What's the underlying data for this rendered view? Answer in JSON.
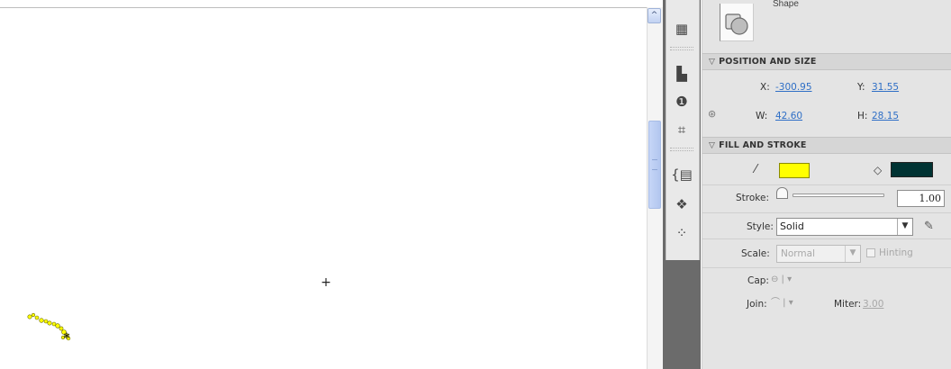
{
  "stage": {
    "crosshair_glyph": "+",
    "scatter_color": "#ffff00"
  },
  "scrollbar": {
    "up_arrow_glyph": "^"
  },
  "icon_strip": {
    "icons": [
      {
        "name": "grid-swatches-icon",
        "glyph": "▦"
      },
      {
        "name": "align-icon",
        "glyph": "▙"
      },
      {
        "name": "info-icon",
        "glyph": "❶"
      },
      {
        "name": "transform-icon",
        "glyph": "⌗"
      },
      {
        "name": "code-snippets-icon",
        "glyph": "{▤"
      },
      {
        "name": "components-icon",
        "glyph": "❖"
      },
      {
        "name": "motion-presets-icon",
        "glyph": "⁘"
      }
    ]
  },
  "properties": {
    "shape_label": "Shape",
    "position_size": {
      "header": "POSITION AND SIZE",
      "x_label": "X:",
      "x_value": "-300.95",
      "y_label": "Y:",
      "y_value": "31.55",
      "w_label": "W:",
      "w_value": "42.60",
      "h_label": "H:",
      "h_value": "28.15",
      "lock_icon": "link-icon"
    },
    "fill_stroke": {
      "header": "FILL AND STROKE",
      "stroke_color": "#ffff00",
      "fill_color": "#003333",
      "stroke_label": "Stroke:",
      "stroke_value": "1.00",
      "style_label": "Style:",
      "style_value": "Solid",
      "scale_label": "Scale:",
      "scale_value": "Normal",
      "hinting_label": "Hinting",
      "cap_label": "Cap:",
      "join_label": "Join:",
      "miter_label": "Miter:",
      "miter_value": "3.00"
    }
  }
}
